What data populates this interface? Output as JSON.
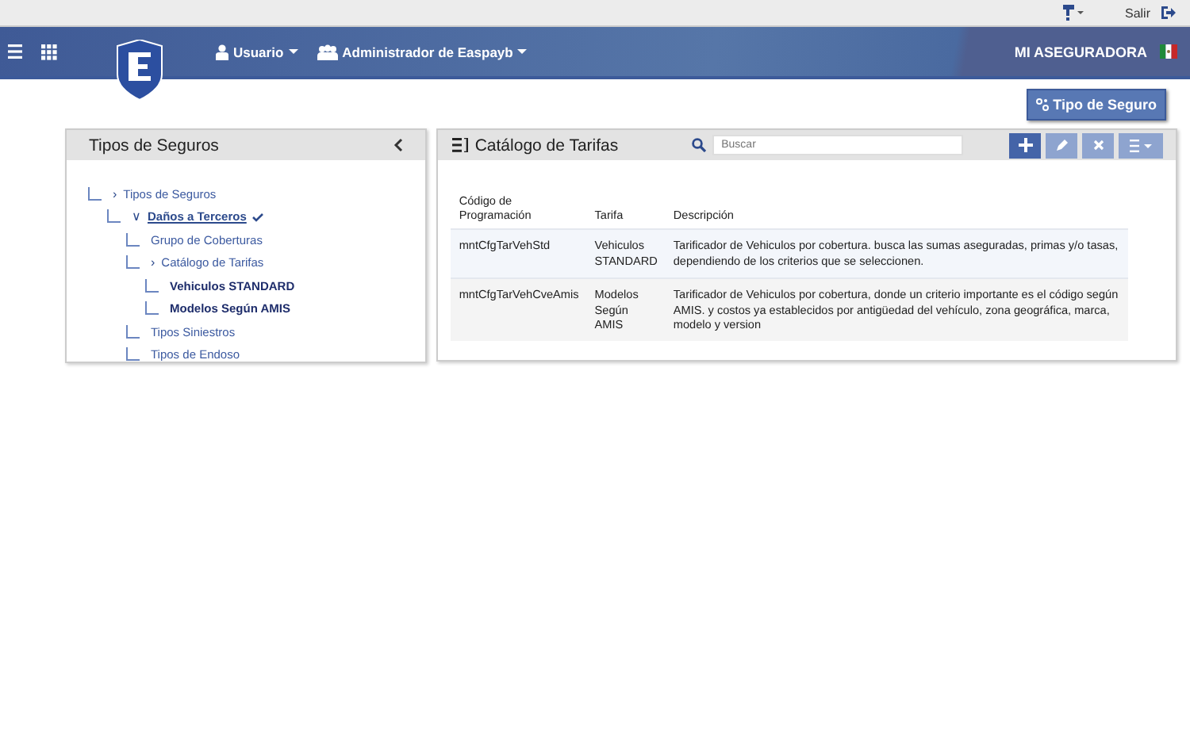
{
  "topbar": {
    "exit": "Salir"
  },
  "header": {
    "menu_items": [
      {
        "label": "Usuario"
      },
      {
        "label": "Administrador de Easpayb"
      }
    ],
    "company": "MI ASEGURADORA"
  },
  "action_button": "Tipo de Seguro",
  "tree_panel": {
    "title": "Tipos de Seguros",
    "items": [
      {
        "label": "Tipos de Seguros",
        "toggle": "›",
        "selected": false,
        "checked": false,
        "kind": "branch",
        "children": [
          {
            "label": "Daños a Terceros",
            "toggle": "∨",
            "selected": true,
            "checked": true,
            "kind": "branch",
            "children": [
              {
                "label": "Grupo de Coberturas",
                "selected": false,
                "checked": false,
                "kind": "branch"
              },
              {
                "label": "Catálogo de Tarifas",
                "toggle": "›",
                "selected": false,
                "checked": false,
                "kind": "branch",
                "children": [
                  {
                    "label": "Vehiculos STANDARD",
                    "selected": false,
                    "checked": false,
                    "kind": "leaf"
                  },
                  {
                    "label": "Modelos Según AMIS",
                    "selected": false,
                    "checked": false,
                    "kind": "leaf"
                  }
                ]
              },
              {
                "label": "Tipos Siniestros",
                "selected": false,
                "checked": false,
                "kind": "branch"
              },
              {
                "label": "Tipos de Endoso",
                "selected": false,
                "checked": false,
                "kind": "branch"
              }
            ]
          }
        ]
      }
    ]
  },
  "catalog_panel": {
    "title": "Catálogo de Tarifas",
    "search": {
      "placeholder": "Buscar"
    },
    "table": {
      "columns": [
        "Código de Programación",
        "Tarifa",
        "Descripción"
      ],
      "rows": [
        [
          "mntCfgTarVehStd",
          "Vehiculos STANDARD",
          "Tarificador de Vehiculos por cobertura. busca las sumas aseguradas, primas y/o tasas, dependiendo de los criterios que se seleccionen."
        ],
        [
          "mntCfgTarVehCveAmis",
          "Modelos Según AMIS",
          "Tarificador de Vehiculos por cobertura, donde un criterio importante es el código según AMIS. y costos ya establecidos por antigüedad del vehículo, zona geográfica, marca, modelo y version"
        ]
      ]
    }
  }
}
